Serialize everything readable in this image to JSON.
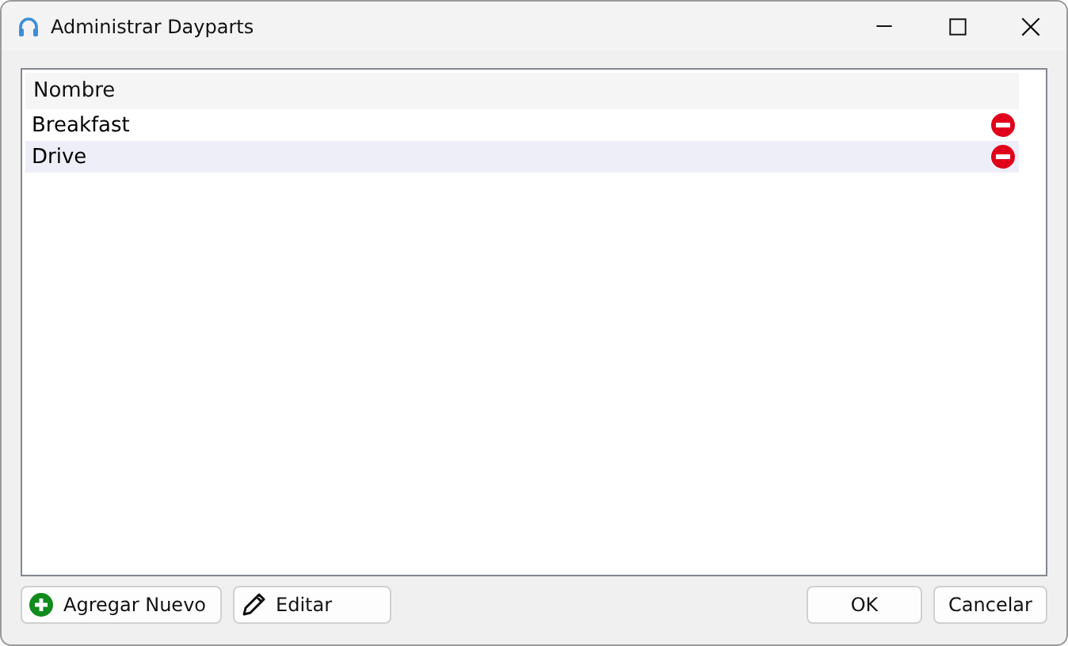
{
  "window": {
    "title": "Administrar Dayparts"
  },
  "table": {
    "columns": [
      "Nombre"
    ],
    "rows": [
      {
        "name": "Breakfast"
      },
      {
        "name": "Drive"
      }
    ]
  },
  "buttons_left": [
    {
      "label": "Agregar Nuevo",
      "kind": "add"
    },
    {
      "label": "Editar",
      "kind": "edit"
    }
  ],
  "buttons_right": [
    {
      "label": "OK"
    },
    {
      "label": "Cancelar"
    }
  ]
}
